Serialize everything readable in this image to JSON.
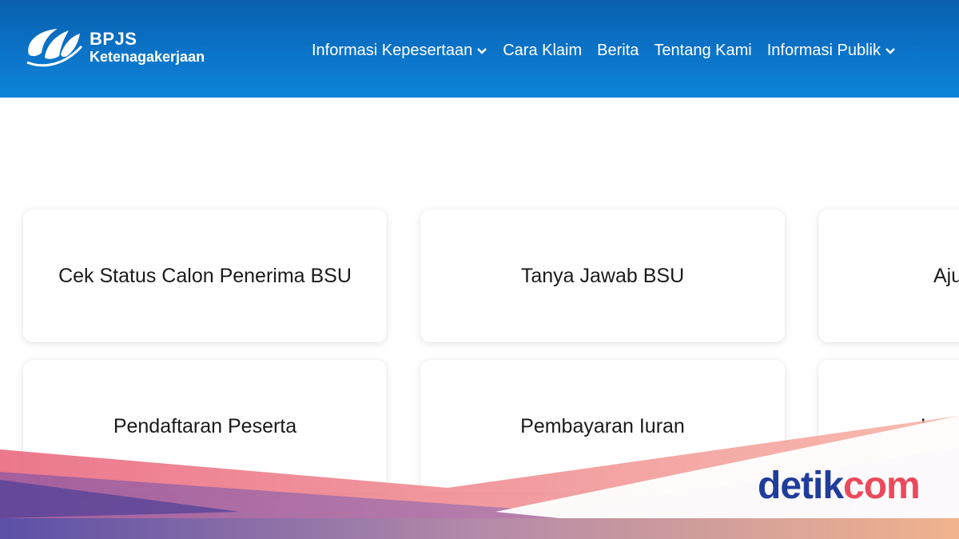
{
  "brand": {
    "title": "BPJS",
    "subtitle": "Ketenagakerjaan"
  },
  "nav": {
    "items": [
      {
        "label": "Informasi Kepesertaan",
        "has_dropdown": true
      },
      {
        "label": "Cara Klaim",
        "has_dropdown": false
      },
      {
        "label": "Berita",
        "has_dropdown": false
      },
      {
        "label": "Tentang Kami",
        "has_dropdown": false
      },
      {
        "label": "Informasi Publik",
        "has_dropdown": true
      }
    ]
  },
  "cards": [
    {
      "label": "Cek Status Calon Penerima BSU"
    },
    {
      "label": "Tanya Jawab BSU"
    },
    {
      "label": "Aju"
    },
    {
      "label": "Pendaftaran Peserta"
    },
    {
      "label": "Pembayaran Iuran"
    },
    {
      "label": "L"
    }
  ],
  "watermark": {
    "part1": "detik",
    "part2": "com"
  },
  "colors": {
    "header": "#0b74c9",
    "watermark_blue": "#1f3d9a",
    "watermark_red": "#ec4a5c"
  }
}
